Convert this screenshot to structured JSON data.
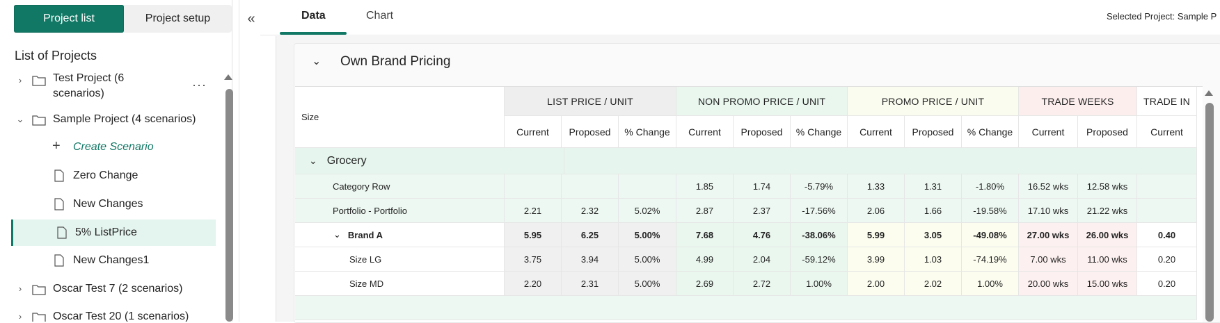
{
  "sidebar": {
    "segment": {
      "project_list": "Project list",
      "project_setup": "Project setup"
    },
    "collapse_icon": "«",
    "list_title": "List of Projects",
    "more_icon": "···",
    "items": [
      {
        "type": "folder",
        "expanded": false,
        "label_line1": "Test Project (6",
        "label_line2": "scenarios)"
      },
      {
        "type": "folder",
        "expanded": true,
        "label": "Sample Project (4 scenarios)"
      },
      {
        "type": "action",
        "icon": "+",
        "label": "Create Scenario"
      },
      {
        "type": "file",
        "label": "Zero Change"
      },
      {
        "type": "file",
        "label": "New Changes"
      },
      {
        "type": "file",
        "label": "5% ListPrice",
        "selected": true
      },
      {
        "type": "file",
        "label": "New Changes1"
      },
      {
        "type": "folder",
        "expanded": false,
        "label": "Oscar Test 7 (2 scenarios)"
      },
      {
        "type": "folder",
        "expanded": false,
        "label": "Oscar Test 20 (1 scenarios)"
      }
    ]
  },
  "tabs": {
    "data": "Data",
    "chart": "Chart"
  },
  "selected_project": "Selected Project: Sample P",
  "section": {
    "title": "Own Brand Pricing",
    "chevron": "⌄"
  },
  "colors": {
    "accent": "#117865",
    "list_price_hdr": "#eeeeee",
    "non_promo_hdr": "#e9f7ef",
    "promo_hdr": "#fbfcf0",
    "trade_weeks_hdr": "#fdeeee",
    "list_price_cell": "#f0f0f0",
    "non_promo_cell": "#eaf7ef",
    "promo_cell": "#fcfdef",
    "trade_weeks_cell": "#fdf0f0",
    "group_row": "#e6f6ee"
  },
  "table": {
    "size_header": "Size",
    "groups": [
      {
        "label": "LIST PRICE / UNIT",
        "color": "#eeeeee"
      },
      {
        "label": "NON PROMO PRICE / UNIT",
        "color": "#e9f7ef"
      },
      {
        "label": "PROMO PRICE / UNIT",
        "color": "#fbfcf0"
      },
      {
        "label": "TRADE WEEKS",
        "color": "#fdeeee"
      },
      {
        "label": "TRADE IN",
        "color": "#ffffff"
      }
    ],
    "subheaders": [
      "Current",
      "Proposed",
      "% Change",
      "Current",
      "Proposed",
      "% Change",
      "Current",
      "Proposed",
      "% Change",
      "Current",
      "Proposed",
      "Current"
    ],
    "group_row_label": "Grocery",
    "rows": [
      {
        "label": "Category Row",
        "bold": false,
        "chev": "",
        "values": [
          "",
          "",
          "",
          "1.85",
          "1.74",
          "-5.79%",
          "1.33",
          "1.31",
          "-1.80%",
          "16.52  wks",
          "12.58  wks",
          ""
        ]
      },
      {
        "label": "Portfolio - Portfolio",
        "bold": false,
        "chev": "",
        "values": [
          "2.21",
          "2.32",
          "5.02%",
          "2.87",
          "2.37",
          "-17.56%",
          "2.06",
          "1.66",
          "-19.58%",
          "17.10  wks",
          "21.22  wks",
          ""
        ]
      },
      {
        "label": "Brand A",
        "bold": true,
        "chev": "⌄",
        "values": [
          "5.95",
          "6.25",
          "5.00%",
          "7.68",
          "4.76",
          "-38.06%",
          "5.99",
          "3.05",
          "-49.08%",
          "27.00 wks",
          "26.00 wks",
          "0.40"
        ]
      },
      {
        "label": "Size LG",
        "bold": false,
        "chev": "",
        "values": [
          "3.75",
          "3.94",
          "5.00%",
          "4.99",
          "2.04",
          "-59.12%",
          "3.99",
          "1.03",
          "-74.19%",
          "7.00  wks",
          "11.00  wks",
          "0.20"
        ]
      },
      {
        "label": "Size MD",
        "bold": false,
        "chev": "",
        "values": [
          "2.20",
          "2.31",
          "5.00%",
          "2.69",
          "2.72",
          "1.00%",
          "2.00",
          "2.02",
          "1.00%",
          "20.00  wks",
          "15.00  wks",
          "0.20"
        ]
      }
    ]
  }
}
